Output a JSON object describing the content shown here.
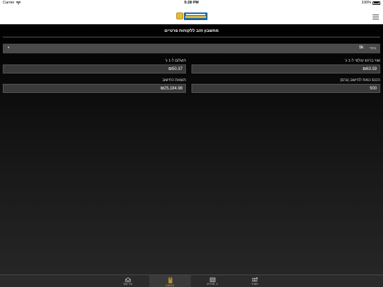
{
  "status_bar": {
    "carrier": "Carrier",
    "time": "5:28 PM",
    "battery": "100%"
  },
  "header": {
    "logo_name": "gold-logo",
    "menu_icon": "hamburger-menu-icon"
  },
  "main": {
    "title": "מחשבון זהב ללקוחות פרטיים",
    "select": {
      "label": "בחר:",
      "value": "9k"
    },
    "fields": {
      "buy_price": {
        "label": "שווי ברוטו עולמי ל-1 ג'",
        "value": "₪63.59"
      },
      "payment": {
        "label": "תשלום ל-1 ג'",
        "value": "₪50.37"
      },
      "grams": {
        "label": "הכנס כמות לחישוב (גרם)",
        "value": "500"
      },
      "result": {
        "label": "תוצאת החישוב",
        "value": "₪25,184.98"
      }
    }
  },
  "tab_bar": {
    "tabs": [
      {
        "label": "צור קשר",
        "icon": "mail-icon",
        "active": false
      },
      {
        "label": "מחשבון",
        "icon": "calculator-icon",
        "active": true
      },
      {
        "label": "ה. מחירים",
        "icon": "calendar-icon",
        "active": false
      },
      {
        "label": "מסחר",
        "icon": "exchange-icon",
        "active": false
      }
    ]
  },
  "colors": {
    "accent": "#c9a542",
    "tab_bar": "#2b2b2b",
    "input_bg": "#3a3a3a"
  }
}
